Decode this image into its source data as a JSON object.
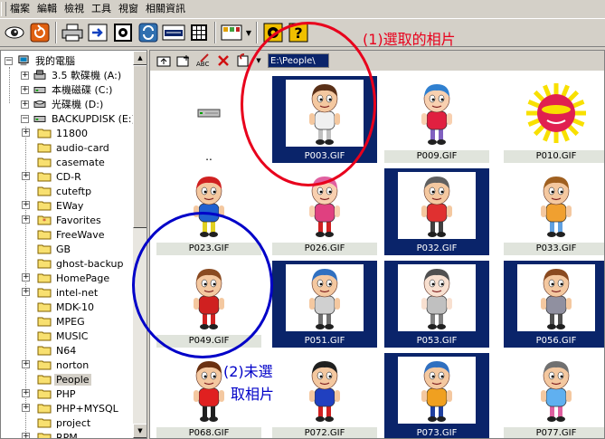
{
  "menu": [
    "檔案",
    "編輯",
    "檢視",
    "工具",
    "視窗",
    "相關資訊"
  ],
  "toolbar_icons": [
    "eye-icon",
    "refresh-icon",
    "print-icon",
    "send-icon",
    "camera-icon",
    "sync-icon",
    "html-icon",
    "grid-icon",
    "thumbnail-view-icon",
    "settings-icon",
    "help-icon"
  ],
  "tree": {
    "root": "我的電腦",
    "drives": [
      "3.5 軟碟機 (A:)",
      "本機磁碟 (C:)",
      "光碟機 (D:)",
      "BACKUPDISK (E:)"
    ],
    "folders": [
      "11800",
      "audio-card",
      "casemate",
      "CD-R",
      "cuteftp",
      "EWay",
      "Favorites",
      "FreeWave",
      "GB",
      "ghost-backup",
      "HomePage",
      "intel-net",
      "MDK-10",
      "MPEG",
      "MUSIC",
      "N64",
      "norton",
      "People",
      "PHP",
      "PHP+MYSQL",
      "project",
      "RPM"
    ],
    "selected": "People"
  },
  "path": "E:\\People\\",
  "thumbnails": [
    {
      "name": "..",
      "selected": false,
      "updir": true
    },
    {
      "name": "P003.GIF",
      "selected": true
    },
    {
      "name": "P009.GIF",
      "selected": false
    },
    {
      "name": "P010.GIF",
      "selected": false
    },
    {
      "name": "P023.GIF",
      "selected": false
    },
    {
      "name": "P026.GIF",
      "selected": false
    },
    {
      "name": "P032.GIF",
      "selected": true
    },
    {
      "name": "P033.GIF",
      "selected": false
    },
    {
      "name": "P049.GIF",
      "selected": false
    },
    {
      "name": "P051.GIF",
      "selected": true
    },
    {
      "name": "P053.GIF",
      "selected": true
    },
    {
      "name": "P056.GIF",
      "selected": true
    },
    {
      "name": "P068.GIF",
      "selected": false
    },
    {
      "name": "P072.GIF",
      "selected": false
    },
    {
      "name": "P073.GIF",
      "selected": true
    },
    {
      "name": "P077.GIF",
      "selected": false
    }
  ],
  "annotations": {
    "selected": "(1)選取的相片",
    "unselected_line1": "(2)未選",
    "unselected_line2": "取相片"
  },
  "colors": {
    "selection": "#0a246a",
    "annotation_red": "#e8001c",
    "annotation_blue": "#0000c8"
  }
}
